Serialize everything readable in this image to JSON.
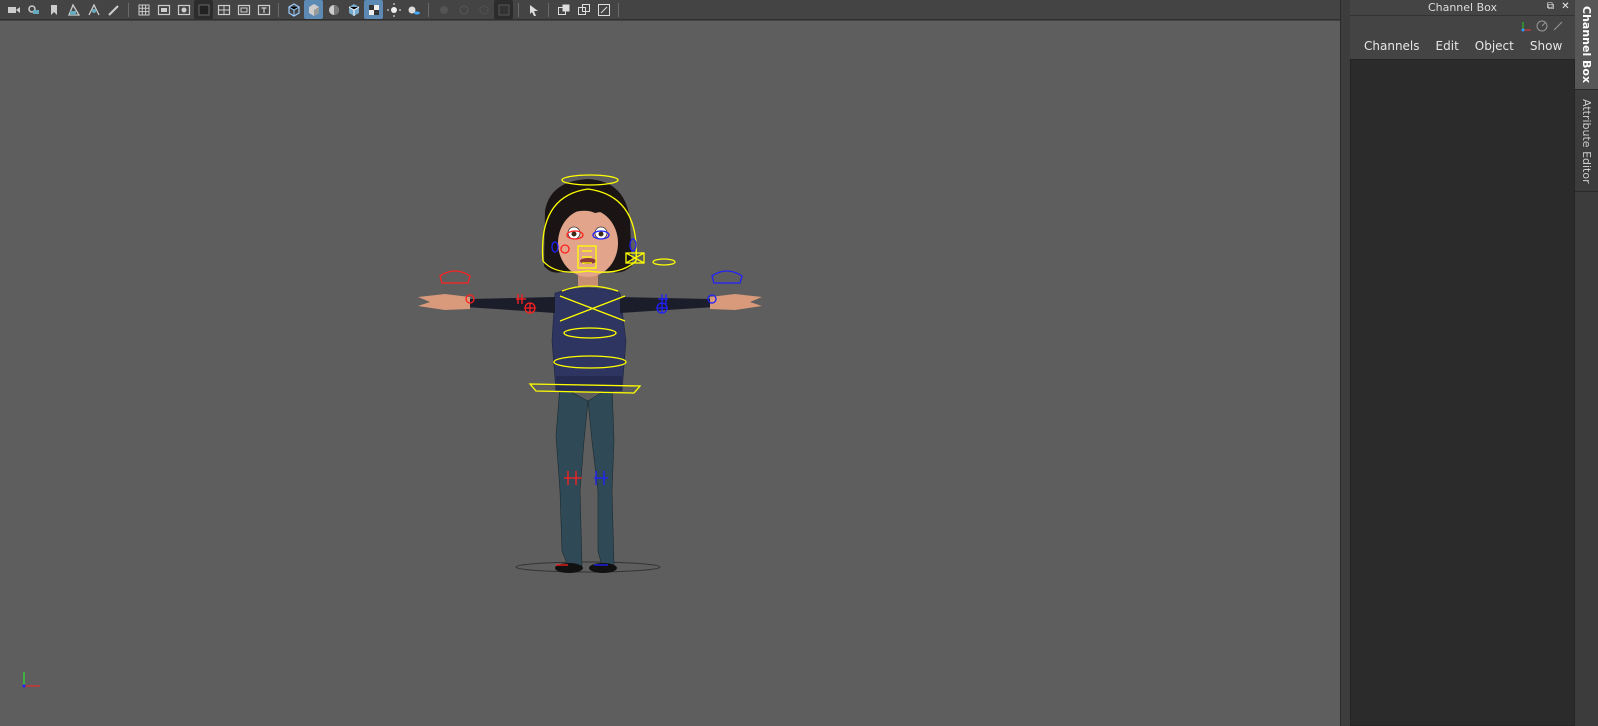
{
  "toolbar": {
    "icons": [
      "camera-icon",
      "camera-attr-icon",
      "bookmark-icon",
      "image-plane-icon",
      "camera-move-icon",
      "pencil-icon",
      "grid-icon",
      "film-gate-icon",
      "resolution-gate-icon",
      "gate-mask-icon",
      "field-chart-icon",
      "safe-action-icon",
      "wireframe-icon",
      "smooth-shade-icon",
      "default-material-icon",
      "wireframe-on-shaded-icon",
      "textured-icon",
      "lights-icon",
      "shadows-icon",
      "ambient-occlusion-icon",
      "motion-blur-icon",
      "anti-alias-icon",
      "depth-of-field-icon",
      "isolate-select-icon",
      "xray-icon",
      "xray-joints-icon",
      "xray-components-icon"
    ]
  },
  "channel_box": {
    "title": "Channel Box",
    "menus": [
      "Channels",
      "Edit",
      "Object",
      "Show"
    ]
  },
  "side_tabs": [
    "Channel Box",
    "Attribute Editor"
  ],
  "colors": {
    "viewport_bg": "#5e5e5e",
    "control_yellow": "#ffff00",
    "control_red": "#ff2020",
    "control_blue": "#2020ff"
  }
}
